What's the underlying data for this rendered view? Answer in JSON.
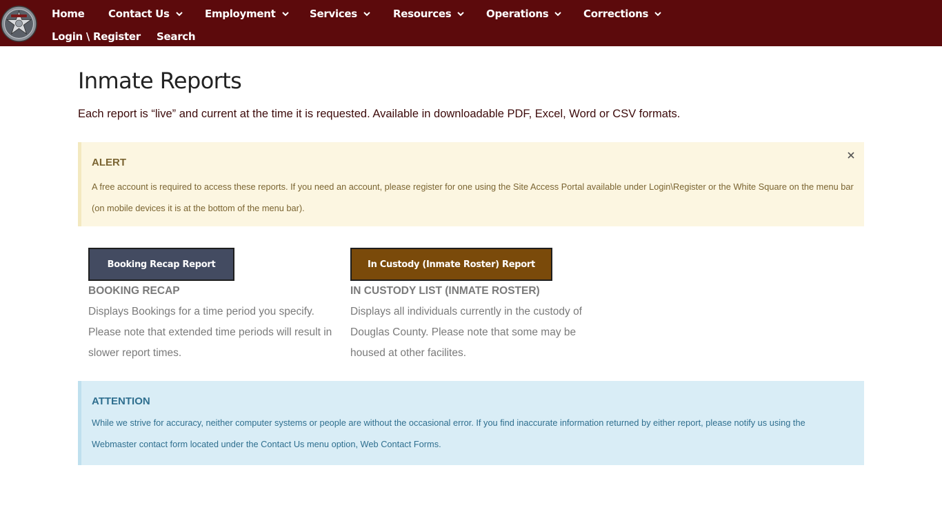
{
  "nav": {
    "items": [
      {
        "label": "Home",
        "dropdown": false
      },
      {
        "label": "Contact Us",
        "dropdown": true
      },
      {
        "label": "Employment",
        "dropdown": true
      },
      {
        "label": "Services",
        "dropdown": true
      },
      {
        "label": "Resources",
        "dropdown": true
      },
      {
        "label": "Operations",
        "dropdown": true
      },
      {
        "label": "Corrections",
        "dropdown": true
      }
    ],
    "secondary": [
      {
        "label": "Login \\ Register"
      },
      {
        "label": "Search"
      }
    ],
    "logo_icon": "sheriff-star-badge-icon",
    "background": "#5c0a0c"
  },
  "page": {
    "title": "Inmate Reports",
    "intro": "Each report is “live” and current at the time it is requested. Available in downloadable PDF, Excel, Word or CSV formats."
  },
  "alert": {
    "title": "ALERT",
    "text": "A free account is required to access these reports. If you need an account, please register for one using the Site Access Portal available under Login\\Register or the White Square on the menu bar (on mobile devices it is at the bottom of the menu bar).",
    "close_icon": "close-icon",
    "background": "#fcf6e1"
  },
  "reports": [
    {
      "button": "Booking Recap Report",
      "title": "BOOKING RECAP",
      "description": "Displays Bookings for a time period you specify. Please note that extended time periods will result in slower report times.",
      "color": "#434b61"
    },
    {
      "button": "In Custody (Inmate Roster) Report",
      "title": "IN CUSTODY LIST (INMATE ROSTER)",
      "description": "Displays all individuals currently in the custody of Douglas County. Please note that some may be housed at other facilites.",
      "color": "#7a4a0a"
    }
  ],
  "attention": {
    "title": "ATTENTION",
    "text": "While we strive for accuracy, neither computer systems or people are without the occasional error. If you find inaccurate information returned by either report, please notify us using the Webmaster contact form located under the Contact Us menu option, Web Contact Forms.",
    "background": "#d9edf6"
  }
}
